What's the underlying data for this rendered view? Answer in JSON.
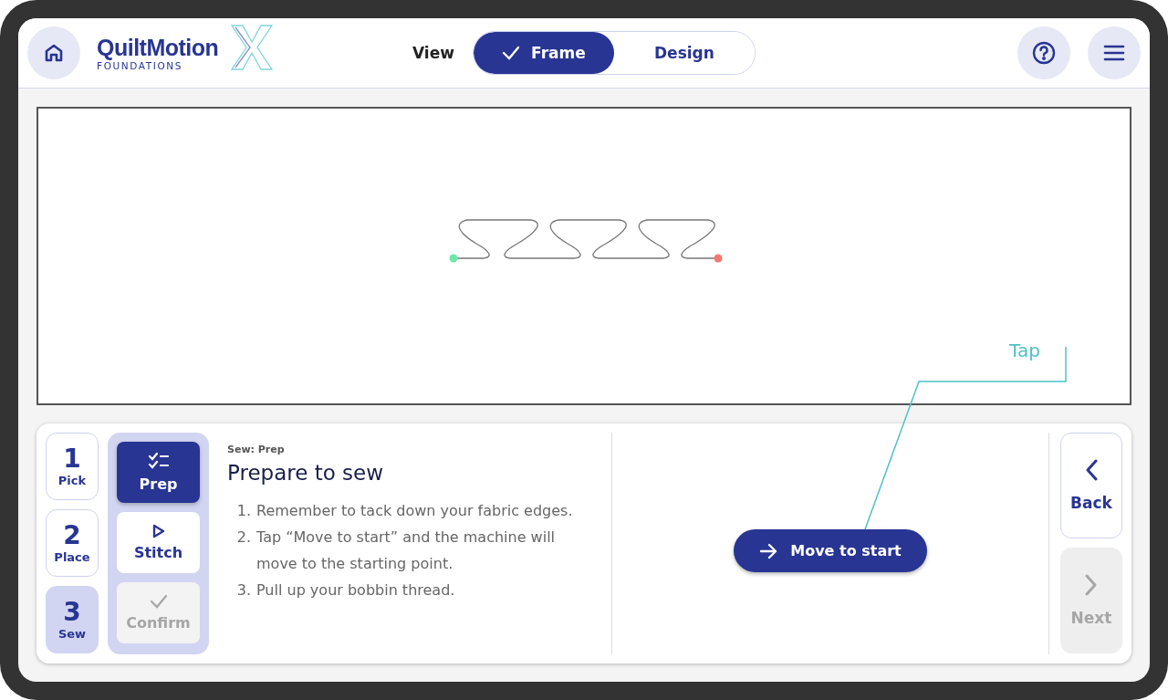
{
  "header": {
    "logo": {
      "title": "QuiltMotion",
      "subtitle": "FOUNDATIONS"
    },
    "view_toggle": {
      "label": "View",
      "options": [
        {
          "label": "Frame",
          "selected": true
        },
        {
          "label": "Design",
          "selected": false
        }
      ]
    }
  },
  "steps": [
    {
      "number": "1",
      "label": "Pick",
      "selected": false
    },
    {
      "number": "2",
      "label": "Place",
      "selected": false
    },
    {
      "number": "3",
      "label": "Sew",
      "selected": true
    }
  ],
  "substeps": [
    {
      "label": "Prep",
      "kind": "checklist",
      "selected": true,
      "disabled": false
    },
    {
      "label": "Stitch",
      "kind": "play",
      "selected": false,
      "disabled": false
    },
    {
      "label": "Confirm",
      "kind": "check",
      "selected": false,
      "disabled": true
    }
  ],
  "content": {
    "eyebrow": "Sew: Prep",
    "title": "Prepare to sew",
    "instructions": [
      {
        "number": "1.",
        "text": "Remember to tack down your fabric edges."
      },
      {
        "number": "2.",
        "text": "Tap “Move to start” and the machine will move to the starting point."
      },
      {
        "number": "3.",
        "text": "Pull up your bobbin thread."
      }
    ]
  },
  "action": {
    "label": "Move to start"
  },
  "nav": {
    "back": {
      "label": "Back",
      "disabled": false
    },
    "next": {
      "label": "Next",
      "disabled": true
    }
  },
  "annotation": {
    "label": "Tap"
  }
}
